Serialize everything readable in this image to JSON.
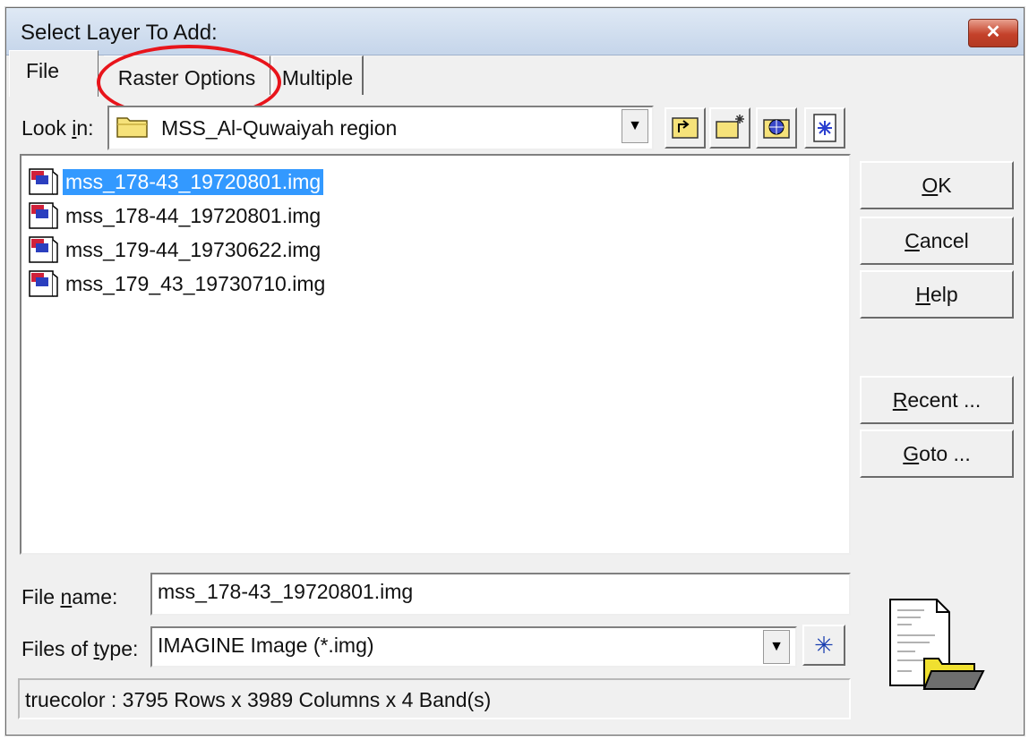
{
  "window": {
    "title": "Select Layer To Add:",
    "close_label": "✕"
  },
  "tabs": [
    {
      "label": "File",
      "active": true
    },
    {
      "label": "Raster Options",
      "active": false,
      "highlighted": true
    },
    {
      "label": "Multiple",
      "active": false
    }
  ],
  "look_in": {
    "label": "Look in:",
    "value": "MSS_Al-Quwaiyah region"
  },
  "toolbar": {
    "icons": [
      "up-folder-icon",
      "new-folder-icon",
      "sphere-icon",
      "star-icon"
    ]
  },
  "files": [
    {
      "name": "mss_178-43_19720801.img",
      "selected": true
    },
    {
      "name": "mss_178-44_19720801.img",
      "selected": false
    },
    {
      "name": "mss_179-44_19730622.img",
      "selected": false
    },
    {
      "name": "mss_179_43_19730710.img",
      "selected": false
    }
  ],
  "buttons": {
    "ok": {
      "mnemonic": "O",
      "rest": "K"
    },
    "cancel": {
      "mnemonic": "C",
      "rest": "ancel"
    },
    "help": {
      "mnemonic": "H",
      "rest": "elp"
    },
    "recent": {
      "mnemonic": "R",
      "rest": "ecent ..."
    },
    "goto": {
      "mnemonic": "G",
      "rest": "oto ..."
    }
  },
  "file_name": {
    "label_pre": "File ",
    "label_mnemonic": "n",
    "label_post": "ame:",
    "value": "mss_178-43_19720801.img"
  },
  "file_type": {
    "label_pre": "Files of ",
    "label_mnemonic": "t",
    "label_post": "ype:",
    "value": "IMAGINE Image (*.img)"
  },
  "status": {
    "text": "truecolor : 3795 Rows x 3989 Columns x 4 Band(s)"
  },
  "colors": {
    "selection": "#3399ff",
    "highlight_circle": "#e8141b",
    "title_bar": "#c5d5ea"
  }
}
